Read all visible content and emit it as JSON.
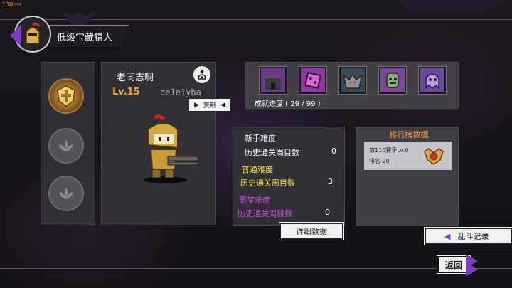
{
  "status": {
    "ping": "130ms"
  },
  "header": {
    "title": "低级宝藏猎人"
  },
  "player": {
    "name": "老同志啊",
    "level": "Lv.15",
    "id": "qe1e1yha",
    "copy_label": "复制"
  },
  "badges": [
    {
      "name": "gold-crest-badge",
      "unlocked": true
    },
    {
      "name": "locked-lotus-badge",
      "unlocked": false
    },
    {
      "name": "locked-lotus-badge",
      "unlocked": false
    }
  ],
  "achievements": {
    "icons": [
      "castle-boss-icon",
      "dice-demon-icon",
      "gargoyle-icon",
      "zombie-icon",
      "ghost-icon"
    ],
    "progress_label": "成就进度 ( 29 / 99 )"
  },
  "difficulty": {
    "novice": {
      "title": "新手难度",
      "row_label": "历史通关周目数",
      "value": "0",
      "color": "#ffffff"
    },
    "normal": {
      "title": "普通难度",
      "row_label": "历史通关周目数",
      "value": "3",
      "color": "#f5e23a"
    },
    "nightmare": {
      "title": "噩梦难度",
      "row_label": "历史通关周目数",
      "value": "0",
      "color": "#c44de0"
    },
    "detail_label": "详细数据"
  },
  "ranking": {
    "header": "排行榜数据",
    "season": "第110赛季Lv.0",
    "rank": "排名 20"
  },
  "buttons": {
    "brawl_label": "乱斗记录",
    "return_label": "返回"
  },
  "colors": {
    "accent_orange": "#f2a23a",
    "purple": "#7a3cc0",
    "panel": "#343238"
  }
}
